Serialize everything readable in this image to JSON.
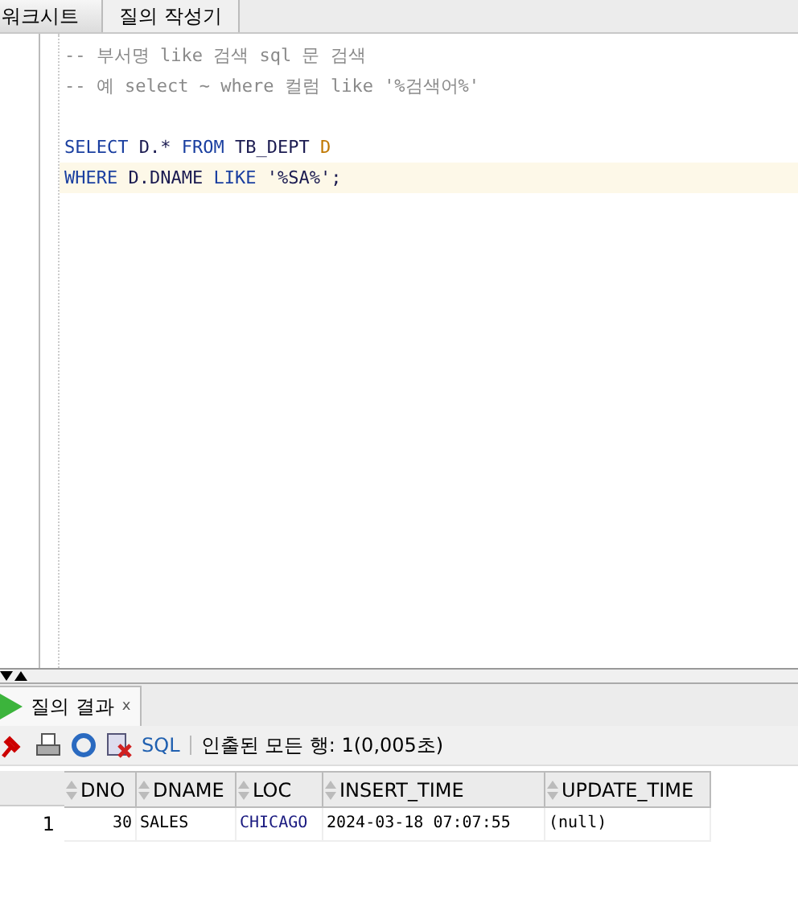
{
  "editor_tabs": [
    {
      "label": "워크시트",
      "selected": true
    },
    {
      "label": "질의 작성기",
      "selected": false
    }
  ],
  "code_lines": [
    {
      "current": false,
      "tokens": [
        {
          "kind": "comment",
          "text": "-- 부서명 like 검색 sql 문 검색"
        }
      ]
    },
    {
      "current": false,
      "tokens": [
        {
          "kind": "comment",
          "text": "-- 예 select ~ where 컬럼 like '%검색어%'"
        }
      ]
    },
    {
      "current": false
    },
    {
      "current": false,
      "tokens": [
        {
          "kind": "keyword",
          "text": "SELECT"
        },
        {
          "kind": "ident",
          "text": " D.* "
        },
        {
          "kind": "keyword",
          "text": "FROM"
        },
        {
          "kind": "ident",
          "text": " TB_DEPT "
        },
        {
          "kind": "alias",
          "text": "D"
        }
      ]
    },
    {
      "current": true,
      "tokens": [
        {
          "kind": "keyword",
          "text": "WHERE"
        },
        {
          "kind": "ident",
          "text": " D.DNAME "
        },
        {
          "kind": "keyword",
          "text": "LIKE"
        },
        {
          "kind": "ident",
          "text": " '%SA%';"
        }
      ]
    }
  ],
  "results": {
    "tab": {
      "label": "질의 결과",
      "close": "x"
    },
    "toolbar": {
      "sql": "SQL",
      "status": "인출된 모든 행: 1(0,005초)"
    },
    "columns": [
      "DNO",
      "DNAME",
      "LOC",
      "INSERT_TIME",
      "UPDATE_TIME"
    ],
    "rows": [
      {
        "number": "1",
        "cells": [
          "30",
          "SALES",
          "CHICAGO",
          "2024-03-18 07:07:55",
          "(null)"
        ]
      }
    ]
  }
}
